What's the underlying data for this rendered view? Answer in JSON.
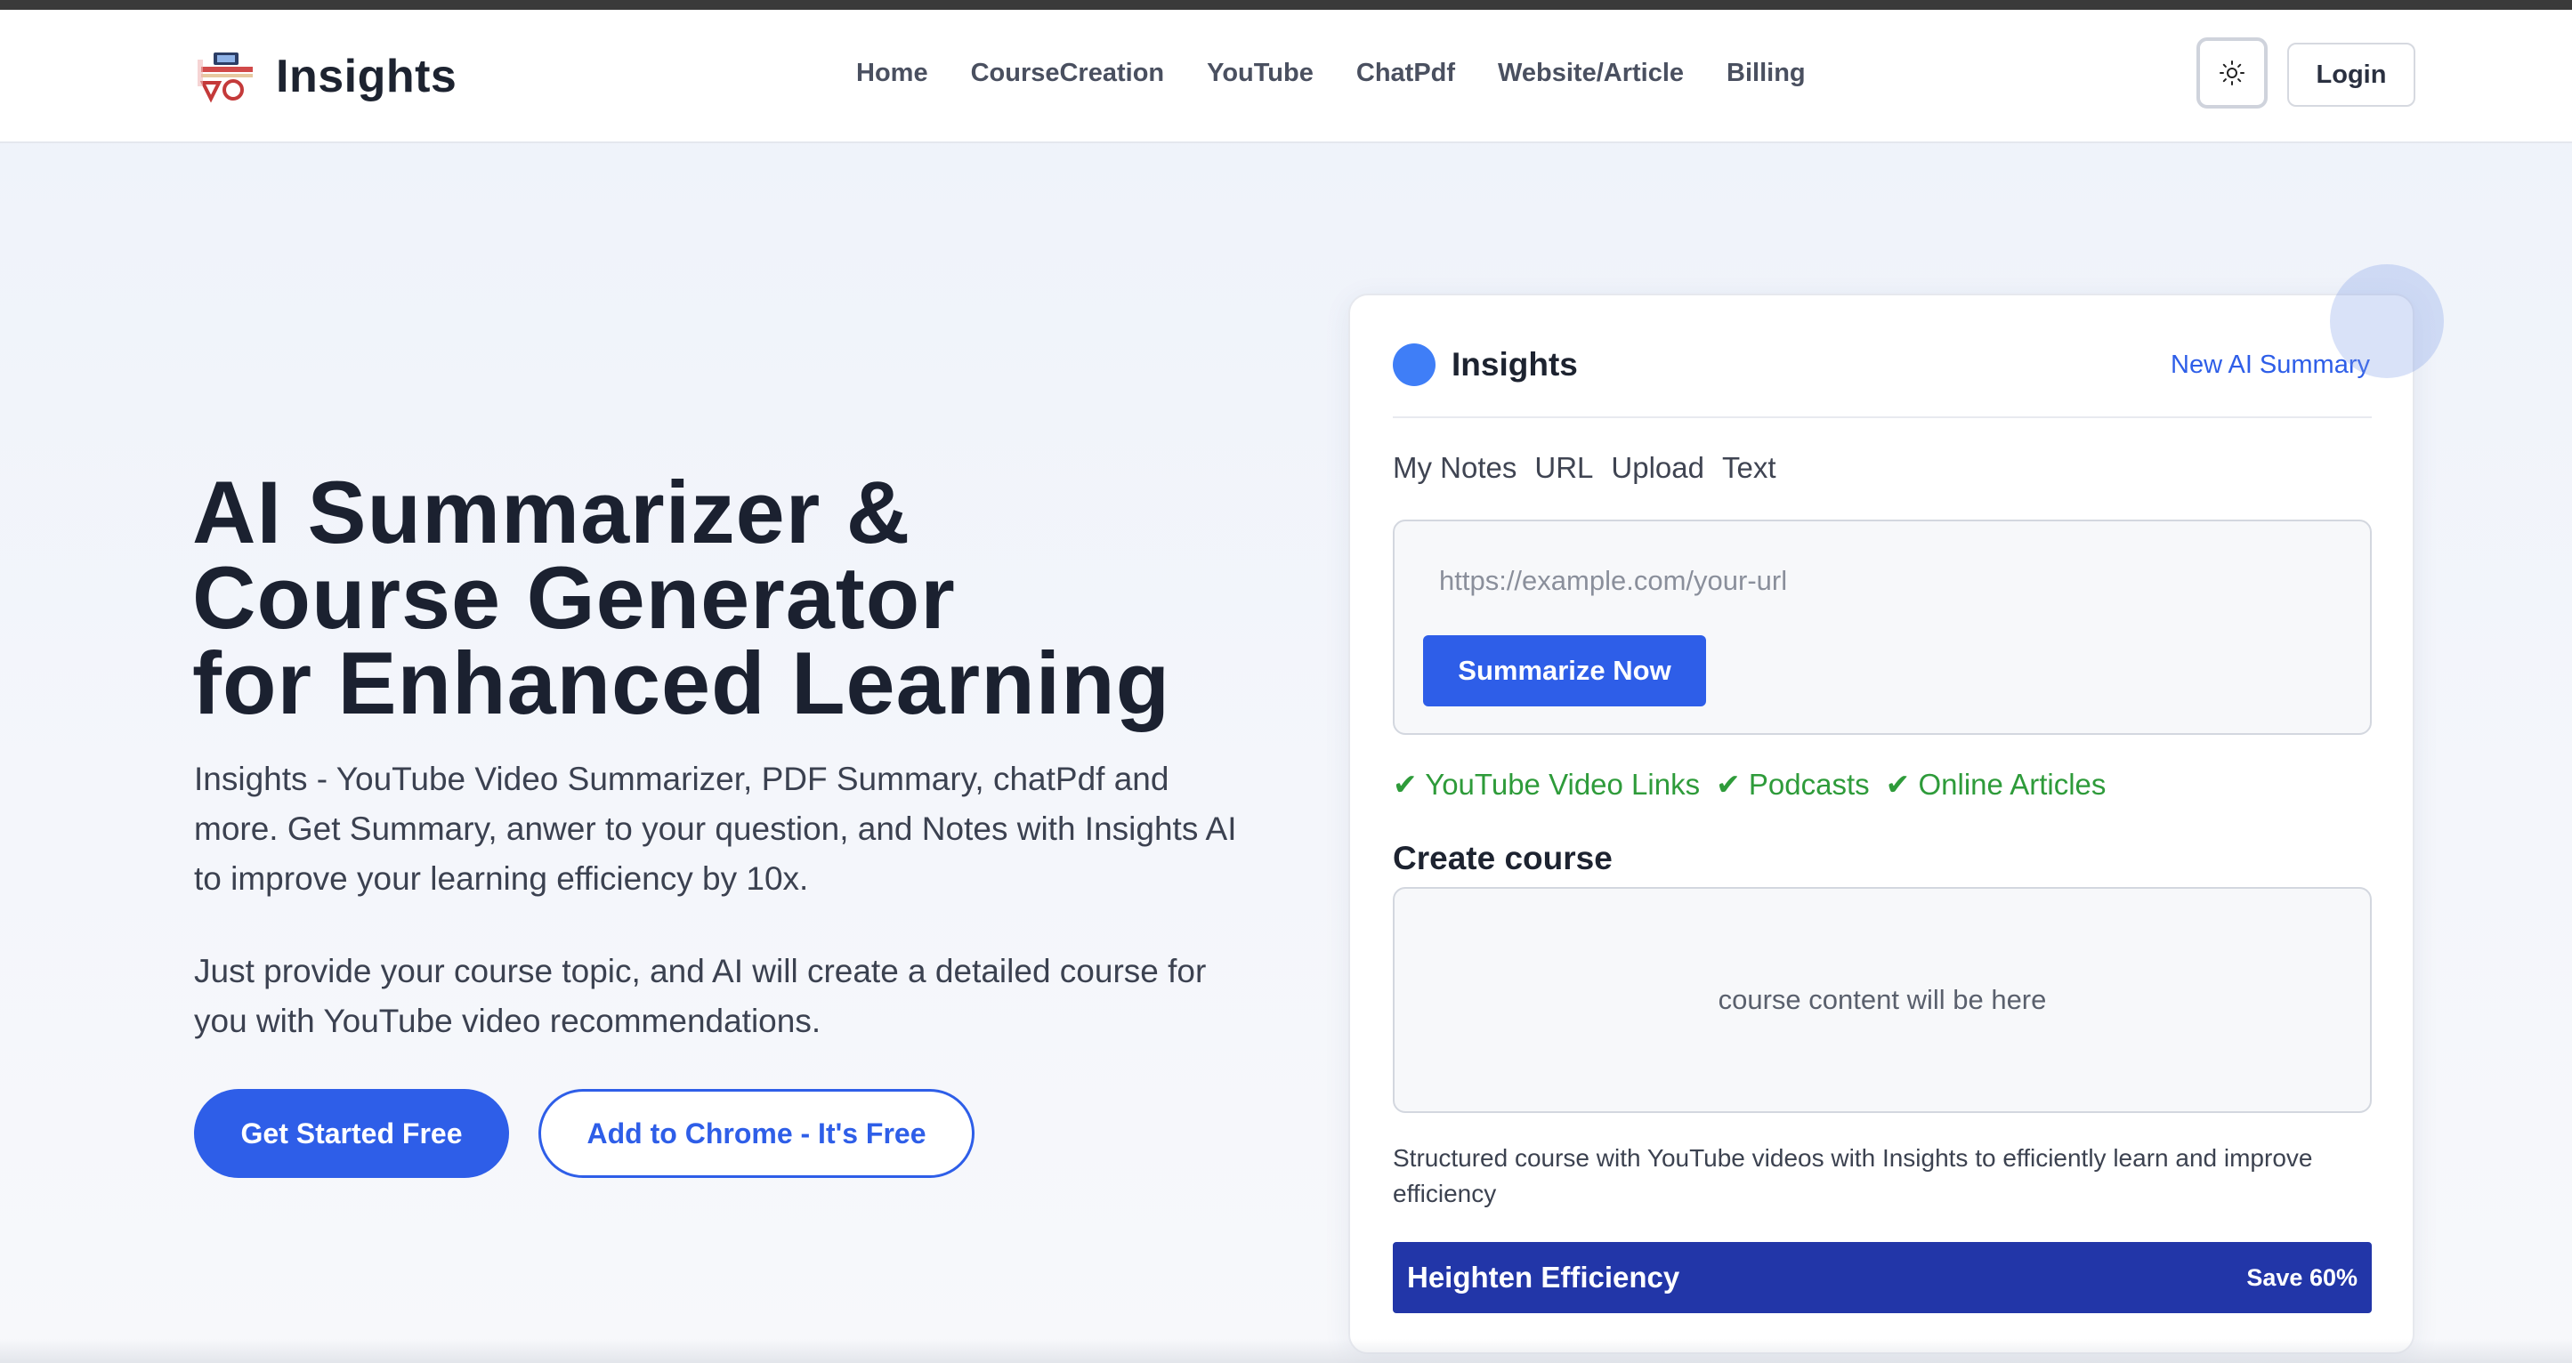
{
  "header": {
    "brand": "Insights",
    "nav": [
      "Home",
      "CourseCreation",
      "YouTube",
      "ChatPdf",
      "Website/Article",
      "Billing"
    ],
    "theme_icon": "sun-icon",
    "login_label": "Login"
  },
  "hero": {
    "title_lines": [
      "AI Summarizer &",
      "Course Generator",
      "for Enhanced Learning"
    ],
    "paragraph1": "Insights - YouTube Video Summarizer, PDF Summary, chatPdf and more. Get Summary, anwer to your question, and Notes with Insights AI to improve your learning efficiency by 10x.",
    "paragraph2": "Just provide your course topic, and AI will create a detailed course for you with YouTube video recommendations.",
    "primary_button": "Get Started Free",
    "secondary_button": "Add to Chrome - It's Free"
  },
  "card": {
    "brand": "Insights",
    "new_summary": "New AI Summary",
    "tabs": [
      "My Notes",
      "URL",
      "Upload",
      "Text"
    ],
    "url_placeholder": "https://example.com/your-url",
    "summarize_button": "Summarize Now",
    "features": [
      "✔ YouTube Video Links",
      "✔ Podcasts",
      "✔ Online Articles"
    ],
    "create_course_title": "Create course",
    "course_placeholder": "course content will be here",
    "course_description": "Structured course with YouTube videos with Insights to efficiently learn and improve efficiency",
    "efficiency_label": "Heighten Efficiency",
    "efficiency_badge": "Save 60%"
  },
  "colors": {
    "accent": "#2e5ee8",
    "feature_green": "#2e9b3a",
    "efficiency_bar": "#2236a8",
    "card_dot": "#3f7ef7"
  }
}
